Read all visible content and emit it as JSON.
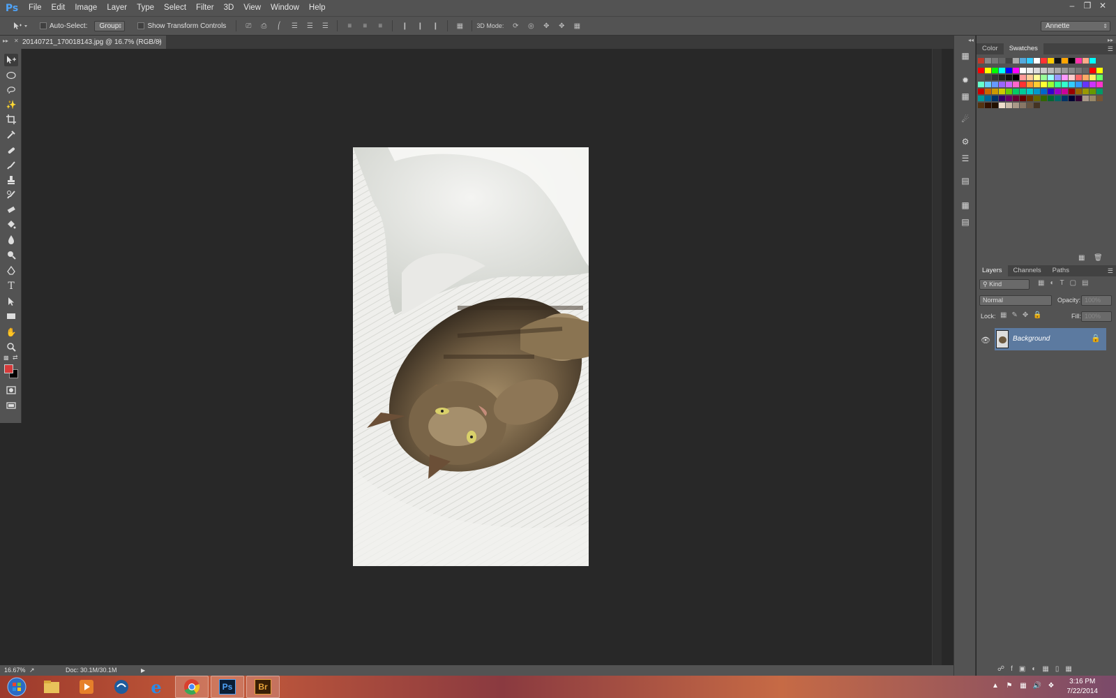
{
  "app": {
    "logo": "Ps"
  },
  "menu": [
    "File",
    "Edit",
    "Image",
    "Layer",
    "Type",
    "Select",
    "Filter",
    "3D",
    "View",
    "Window",
    "Help"
  ],
  "options": {
    "auto_select_label": "Auto-Select:",
    "auto_select_value": "Group",
    "show_transform_label": "Show Transform Controls",
    "mode_label": "3D Mode:",
    "workspace": "Annette"
  },
  "document": {
    "tab_title": "20140721_170018143.jpg @ 16.7% (RGB/8)",
    "close": "×"
  },
  "status": {
    "zoom": "16.67%",
    "doc_info": "Doc: 30.1M/30.1M"
  },
  "panels": {
    "top_tabs": [
      "Color",
      "Swatches"
    ],
    "active_top_tab": "Swatches",
    "layer_tabs": [
      "Layers",
      "Channels",
      "Paths"
    ],
    "filter_kind": "Kind",
    "blend_mode": "Normal",
    "opacity_label": "Opacity:",
    "opacity_value": "100%",
    "lock_label": "Lock:",
    "fill_label": "Fill:",
    "fill_value": "100%",
    "layer_name": "Background"
  },
  "colors": {
    "foreground": "#d63a3a",
    "background": "#000000",
    "layer_selected": "#5c7aa0"
  },
  "taskbar": {
    "time": "3:16 PM",
    "date": "7/22/2014",
    "apps": [
      "windows-start",
      "file-explorer",
      "media-player",
      "wireless-util",
      "internet-explorer",
      "chrome",
      "photoshop",
      "bridge"
    ]
  }
}
